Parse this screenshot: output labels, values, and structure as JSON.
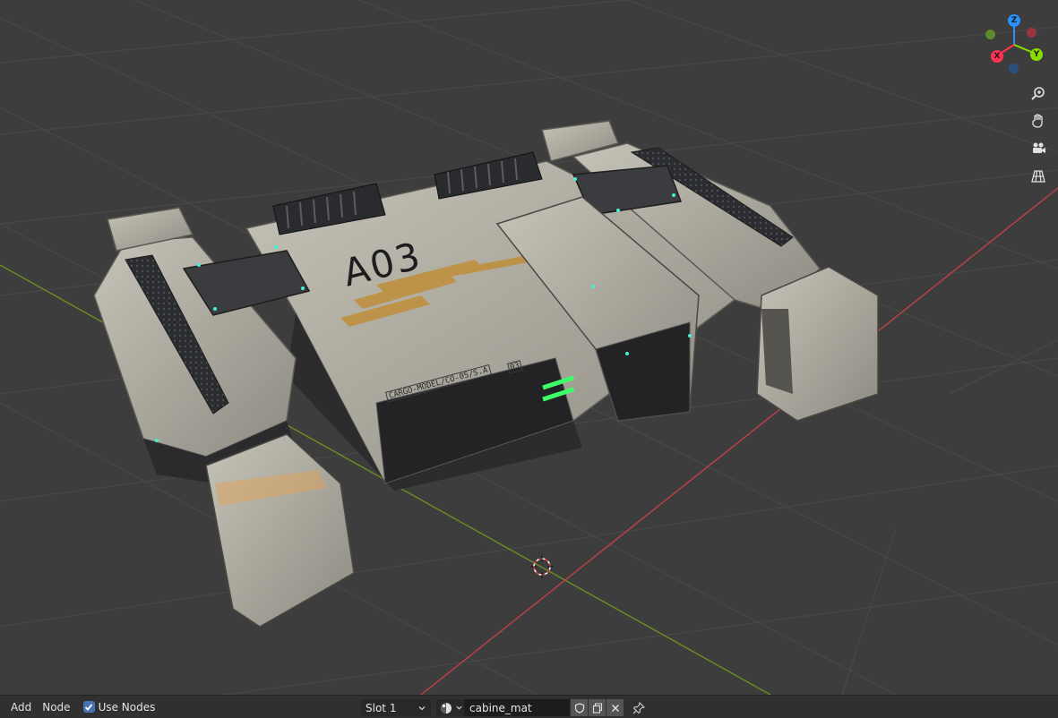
{
  "viewport": {
    "model_text": "A03",
    "model_label": "CARGO-MODEL/CO-05/S.A",
    "model_tag": "03",
    "gizmo": {
      "z_label": "Z",
      "x_label": "X",
      "y_label": "Y",
      "colors": {
        "x": "#ff3352",
        "y": "#8bdc00",
        "z": "#2890ff"
      }
    },
    "nav_icons": [
      "zoom-icon",
      "hand-pan-icon",
      "camera-icon",
      "perspective-grid-icon"
    ]
  },
  "header": {
    "menu_add": "Add",
    "menu_node": "Node",
    "use_nodes_label": "Use Nodes",
    "use_nodes_checked": true,
    "slot_value": "Slot 1",
    "material_name": "cabine_mat"
  },
  "colors": {
    "accent": "#4772b3",
    "background": "#3d3d3d",
    "header": "#303030"
  }
}
